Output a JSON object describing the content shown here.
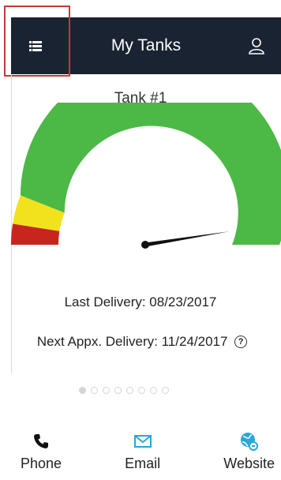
{
  "header": {
    "title": "My Tanks",
    "menu_icon": "list-menu-icon",
    "user_icon": "user-profile-icon",
    "background": "#1a2332"
  },
  "tank": {
    "name": "Tank #1",
    "level_fraction": 0.95,
    "zones": [
      {
        "name": "critical",
        "color": "#c8251f",
        "from": 0.0,
        "to": 0.05
      },
      {
        "name": "low",
        "color": "#f2e21d",
        "from": 0.05,
        "to": 0.12
      },
      {
        "name": "ok",
        "color": "#4cb846",
        "from": 0.12,
        "to": 1.0
      }
    ]
  },
  "delivery": {
    "last": "Last Delivery: 08/23/2017",
    "next": "Next Appx. Delivery: 11/24/2017",
    "help_icon": "help-circle-icon"
  },
  "pager": {
    "count": 8,
    "active": 0
  },
  "contact": [
    {
      "label": "Phone",
      "icon": "phone-icon",
      "color": "#111111"
    },
    {
      "label": "Email",
      "icon": "email-icon",
      "color": "#2aa6d9"
    },
    {
      "label": "Website",
      "icon": "globe-link-icon",
      "color": "#2aa6d9"
    }
  ]
}
